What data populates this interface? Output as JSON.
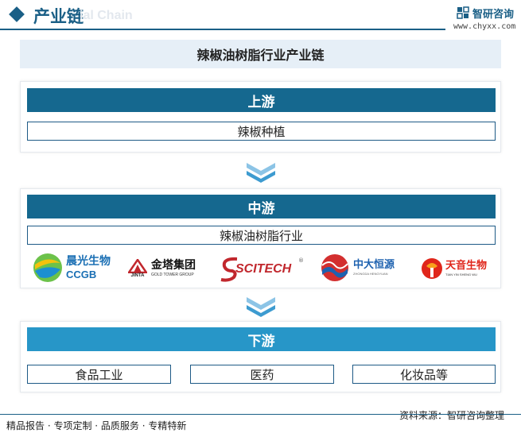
{
  "header": {
    "title": "产业链",
    "ghost_text": "ial Chain",
    "brand_name": "智研咨询",
    "brand_url": "www.chyxx.com"
  },
  "title": "辣椒油树脂行业产业链",
  "upstream": {
    "label": "上游",
    "items": [
      "辣椒种植"
    ]
  },
  "midstream": {
    "label": "中游",
    "items": [
      "辣椒油树脂行业"
    ],
    "logos": [
      {
        "name": "晨光生物",
        "sub": "CCGB"
      },
      {
        "name": "金塔集团",
        "sub": "GOLD TOWER GROUP",
        "prefix": "JINTA"
      },
      {
        "name": "SCITECH"
      },
      {
        "name": "中大恒源",
        "sub": "ZHONGDA HENGYUAN"
      },
      {
        "name": "天音生物",
        "sub": "TIAN YIN SHENG WU"
      }
    ]
  },
  "downstream": {
    "label": "下游",
    "items": [
      "食品工业",
      "医药",
      "化妆品等"
    ]
  },
  "footer": {
    "left": "精品报告 · 专项定制 · 品质服务 · 专精特新",
    "right": "资料来源：智研咨询整理"
  },
  "colors": {
    "primary": "#15688f",
    "light": "#2796c8",
    "band": "#e6eff7"
  }
}
